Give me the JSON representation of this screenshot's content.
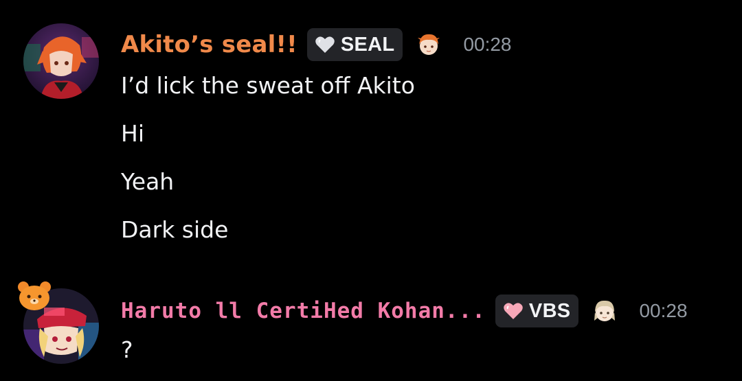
{
  "messages": [
    {
      "username": "Akito’s seal!!",
      "username_color": "#f0894a",
      "role_tag": "SEAL",
      "role_tag_heart_color": "#dfe1e6",
      "timestamp": "00:28",
      "role_icon": "orange-haired-chibi-icon",
      "lines": [
        "I’d lick the sweat off Akito",
        "Hi",
        "Yeah",
        "Dark side"
      ]
    },
    {
      "username": "Haruto ll CertiHed Kohan...",
      "username_color": "#f27ba8",
      "role_tag": "VBS",
      "role_tag_heart_color": "#f7a8b8",
      "timestamp": "00:28",
      "role_icon": "beige-haired-chibi-icon",
      "lines": [
        "?"
      ]
    }
  ],
  "colors": {
    "background": "#000000",
    "tag_background": "#232428",
    "timestamp": "#949ba4",
    "message_text": "#f2f3f5"
  }
}
